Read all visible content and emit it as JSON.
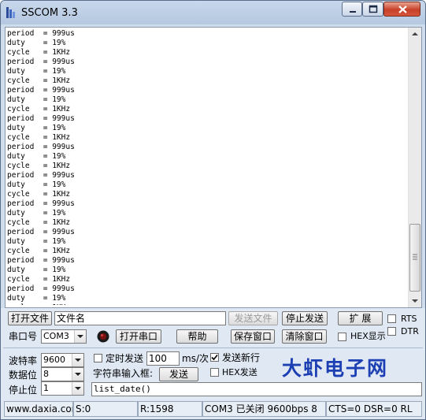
{
  "window": {
    "title": "SSCOM 3.3"
  },
  "terminal": {
    "lines": [
      "period  = 999us",
      "duty    = 19%",
      "cycle   = 1KHz",
      "period  = 999us",
      "duty    = 19%",
      "cycle   = 1KHz",
      "period  = 999us",
      "duty    = 19%",
      "cycle   = 1KHz",
      "period  = 999us",
      "duty    = 19%",
      "cycle   = 1KHz",
      "period  = 999us",
      "duty    = 19%",
      "cycle   = 1KHz",
      "period  = 999us",
      "duty    = 19%",
      "cycle   = 1KHz",
      "period  = 999us",
      "duty    = 19%",
      "cycle   = 1KHz",
      "period  = 999us",
      "duty    = 19%",
      "cycle   = 1KHz",
      "period  = 999us",
      "duty    = 19%",
      "cycle   = 1KHz",
      "period  = 999us",
      "duty    = 19%",
      "cycle   = 1KHz",
      "period  = 999us",
      "duty    = 19%",
      "cycle   = 1KHz",
      "period  = 999us"
    ]
  },
  "toolbar": {
    "open_file": "打开文件",
    "file_name": "文件名",
    "send_file": "发送文件",
    "stop_send": "停止发送",
    "expand": "扩 展",
    "rts": "RTS",
    "dtr": "DTR",
    "port_label": "串口号",
    "port_value": "COM3",
    "open_port": "打开串口",
    "help": "帮助",
    "save_window": "保存窗口",
    "clear_window": "清除窗口",
    "hex_display": "HEX显示"
  },
  "settings": {
    "baud_label": "波特率",
    "baud_value": "9600",
    "data_label": "数据位",
    "data_value": "8",
    "stop_label": "停止位",
    "stop_value": "1",
    "timed_send": "定时发送",
    "interval_value": "100",
    "interval_unit": "ms/次",
    "send_newline": "发送新行",
    "input_label": "字符串输入框:",
    "send": "发送",
    "hex_send": "HEX发送",
    "send_text": "list_date()",
    "brand": "大虾电子网"
  },
  "status": {
    "site": "www.daxia.cor",
    "sent": "S:0",
    "received": "R:1598",
    "port_state": "COM3 已关闭  9600bps  8",
    "lines_state": "CTS=0 DSR=0 RL"
  }
}
